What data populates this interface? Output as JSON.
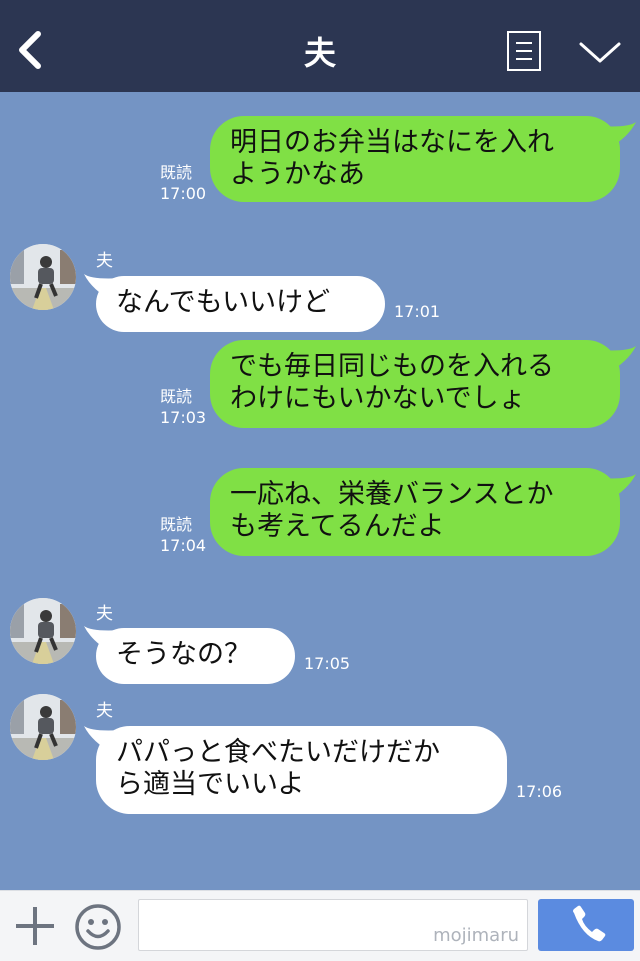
{
  "header": {
    "title": "夫",
    "back_icon": "chevron-left-icon",
    "menu_icon": "menu-list-icon",
    "dropdown_icon": "chevron-down-icon",
    "bg_color": "#2c3652"
  },
  "chat": {
    "bg_color": "#7494c4",
    "messages": [
      {
        "direction": "out",
        "text": "明日のお弁当はなにを入れ\nようかなあ",
        "read": "既読",
        "time": "17:00"
      },
      {
        "direction": "in",
        "sender": "夫",
        "text": "なんでもいいけど",
        "time": "17:01"
      },
      {
        "direction": "out",
        "text": "でも毎日同じものを入れる\nわけにもいかないでしょ",
        "read": "既読",
        "time": "17:03"
      },
      {
        "direction": "out",
        "text": "一応ね、栄養バランスとか\nも考えてるんだよ",
        "read": "既読",
        "time": "17:04"
      },
      {
        "direction": "in",
        "sender": "夫",
        "text": "そうなの？",
        "time": "17:05"
      },
      {
        "direction": "in",
        "sender": "夫",
        "text": "パパっと食べたいだけだか\nら適当でいいよ",
        "time": "17:06"
      }
    ]
  },
  "input_bar": {
    "plus_icon": "plus-icon",
    "emoji_icon": "smiley-icon",
    "input_value": "",
    "watermark": "mojimaru",
    "call_icon": "phone-icon"
  },
  "colors": {
    "outgoing_bubble": "#80e045",
    "incoming_bubble": "#ffffff",
    "call_button": "#5b8be0"
  }
}
